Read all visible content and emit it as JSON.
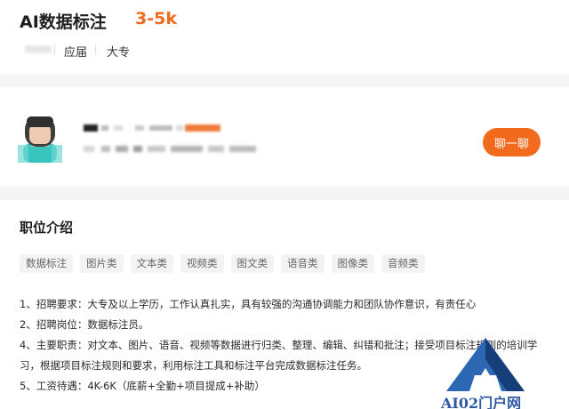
{
  "job": {
    "title": "AI数据标注",
    "salary": "3-5k",
    "meta": [
      "应届",
      "大专"
    ]
  },
  "recruiter": {
    "chat_label": "聊一聊"
  },
  "description": {
    "section_title": "职位介绍",
    "tags": [
      "数据标注",
      "图片类",
      "文本类",
      "视频类",
      "图文类",
      "语音类",
      "图像类",
      "音频类"
    ],
    "lines": [
      "1、招聘要求：大专及以上学历，工作认真扎实，具有较强的沟通协调能力和团队协作意识，有责任心",
      "2、招聘岗位：数据标注员。",
      "4、主要职责：对文本、图片、语音、视频等数据进行归类、整理、编辑、纠错和批注；接受项目标注规则的培训学",
      "习，根据项目标注规则和要求，利用标注工具和标注平台完成数据标注任务。",
      "5、工资待遇：4K-6K（底薪+全勤+项目提成+补助）"
    ]
  },
  "watermark": {
    "text": "AI02门户网"
  },
  "colors": {
    "accent": "#f26b1d",
    "tag_bg": "#f3f3f3",
    "watermark_blue": "#2f58a6"
  }
}
